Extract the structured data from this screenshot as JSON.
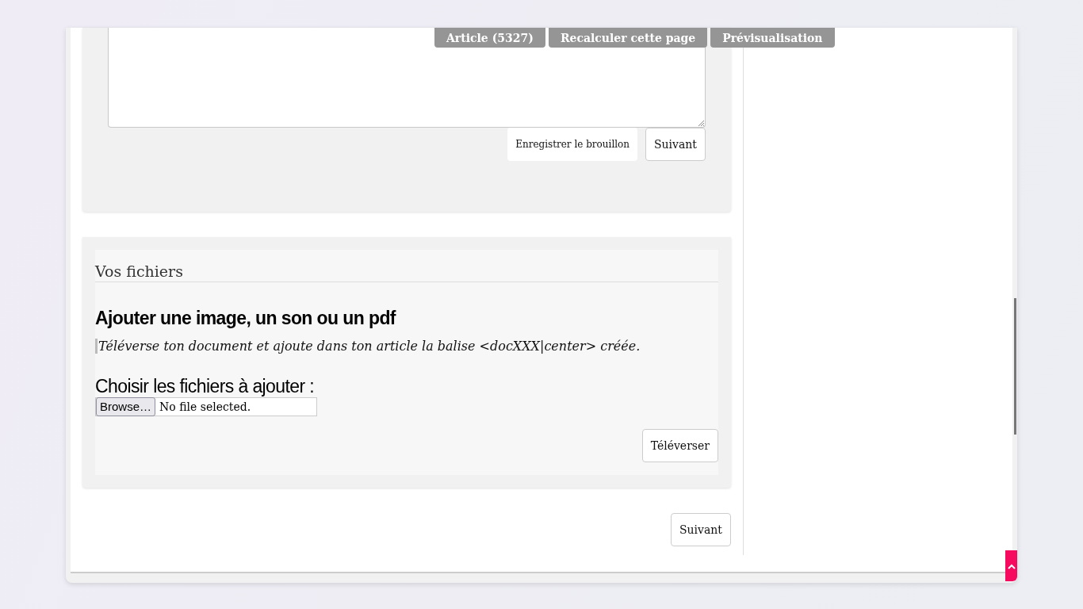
{
  "toolbar": {
    "buttons": [
      "Article (5327)",
      "Recalculer cette page",
      "Prévisualisation"
    ]
  },
  "editor": {
    "buttons": [
      {
        "label": "Enregistrer le brouillon",
        "kind": "flat"
      },
      {
        "label": "Suivant",
        "kind": "outline"
      }
    ]
  },
  "files_panel": {
    "title": "Vos fichiers",
    "heading": "Ajouter une image, un son ou un pdf",
    "hint": "Téléverse ton document et ajoute dans ton article la balise <docXXX|center> créée.",
    "choose_label": "Choisir les fichiers à ajouter :",
    "file_input": {
      "button": "Browse…",
      "value": "No file selected."
    },
    "upload_button": "Téléverser"
  },
  "footer": {
    "next_button": "Suivant"
  }
}
